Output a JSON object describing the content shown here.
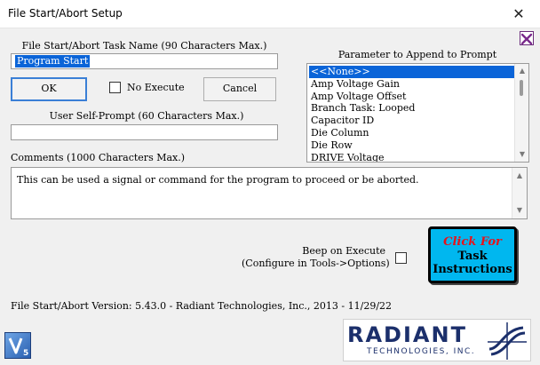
{
  "window": {
    "title": "File Start/Abort Setup",
    "close_glyph": "✕"
  },
  "task_name": {
    "label": "File Start/Abort Task Name (90 Characters Max.)",
    "value": "Program Start"
  },
  "buttons": {
    "ok": "OK",
    "cancel": "Cancel"
  },
  "no_execute": {
    "label": "No Execute",
    "checked": false
  },
  "self_prompt": {
    "label": "User Self-Prompt (60 Characters Max.)",
    "value": ""
  },
  "parameter_list": {
    "label": "Parameter to Append to Prompt",
    "items": [
      "<<None>>",
      "Amp Voltage Gain",
      "Amp Voltage Offset",
      "Branch Task: Looped",
      "Capacitor ID",
      "Die Column",
      "Die Row",
      "DRIVE Voltage"
    ],
    "selected_index": 0
  },
  "comments": {
    "label": "Comments (1000 Characters Max.)",
    "value": "This can be used a signal or command for the program to proceed or be aborted."
  },
  "beep": {
    "label_line1": "Beep on Execute",
    "label_line2": "(Configure in Tools->Options)",
    "checked": false
  },
  "task_instructions": {
    "line1": "Click For",
    "line2": "Task",
    "line3": "Instructions"
  },
  "version_text": "File Start/Abort Version: 5.43.0 - Radiant Technologies, Inc., 2013 - 11/29/22",
  "logo": {
    "word": "RADIANT",
    "sub": "TECHNOLOGIES, INC."
  },
  "colors": {
    "selection": "#0a64d8",
    "task_button": "#00b7ef",
    "click_for": "#e8121a",
    "logo": "#1b2f6b"
  }
}
